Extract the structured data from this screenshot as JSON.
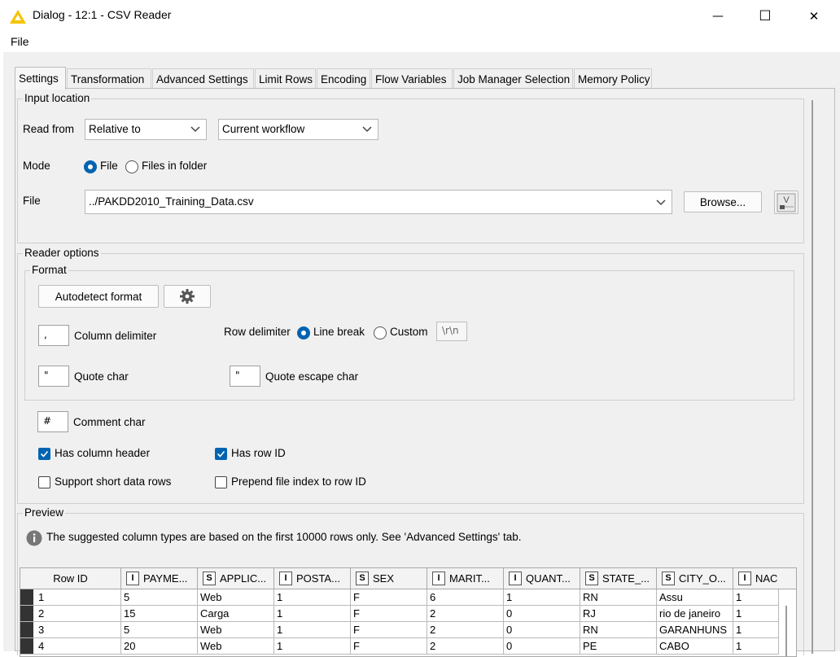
{
  "window": {
    "title": "Dialog - 12:1 - CSV Reader",
    "minimize": "—",
    "maximize": "☐",
    "close": "✕"
  },
  "menu": {
    "file": "File"
  },
  "tabs": [
    "Settings",
    "Transformation",
    "Advanced Settings",
    "Limit Rows",
    "Encoding",
    "Flow Variables",
    "Job Manager Selection",
    "Memory Policy"
  ],
  "input_location": {
    "legend": "Input location",
    "read_from_label": "Read from",
    "read_from_value": "Relative to",
    "read_from_target": "Current workflow",
    "mode_label": "Mode",
    "mode_file": "File",
    "mode_folder": "Files in folder",
    "file_label": "File",
    "file_value": "../PAKDD2010_Training_Data.csv",
    "browse": "Browse...",
    "var_button": "V"
  },
  "reader_options": {
    "legend": "Reader options",
    "format_legend": "Format",
    "autodetect": "Autodetect format",
    "column_delimiter_value": ",",
    "column_delimiter_label": "Column delimiter",
    "row_delimiter_label": "Row delimiter",
    "line_break": "Line break",
    "custom": "Custom",
    "custom_value": "\\r\\n",
    "quote_char_value": "\"",
    "quote_char_label": "Quote char",
    "quote_escape_value": "\"",
    "quote_escape_label": "Quote escape char",
    "comment_char_value": "#",
    "comment_char_label": "Comment char",
    "has_column_header": "Has column header",
    "has_row_id": "Has row ID",
    "support_short_rows": "Support short data rows",
    "prepend_file_index": "Prepend file index to row ID"
  },
  "preview": {
    "legend": "Preview",
    "info": "The suggested column types are based on the first 10000 rows only. See 'Advanced Settings' tab.",
    "row_id_header": "Row ID",
    "columns": [
      {
        "type": "I",
        "name": "PAYME..."
      },
      {
        "type": "S",
        "name": "APPLIC..."
      },
      {
        "type": "I",
        "name": "POSTA..."
      },
      {
        "type": "S",
        "name": "SEX"
      },
      {
        "type": "I",
        "name": "MARIT..."
      },
      {
        "type": "I",
        "name": "QUANT..."
      },
      {
        "type": "S",
        "name": "STATE_..."
      },
      {
        "type": "S",
        "name": "CITY_O..."
      },
      {
        "type": "I",
        "name": "NAC"
      }
    ],
    "rows": [
      [
        "1",
        "5",
        "Web",
        "1",
        "F",
        "6",
        "1",
        "RN",
        "Assu",
        "1"
      ],
      [
        "2",
        "15",
        "Carga",
        "1",
        "F",
        "2",
        "0",
        "RJ",
        "rio de janeiro",
        "1"
      ],
      [
        "3",
        "5",
        "Web",
        "1",
        "F",
        "2",
        "0",
        "RN",
        "GARANHUNS",
        "1"
      ],
      [
        "4",
        "20",
        "Web",
        "1",
        "F",
        "2",
        "0",
        "PE",
        "CABO",
        "1"
      ]
    ]
  }
}
